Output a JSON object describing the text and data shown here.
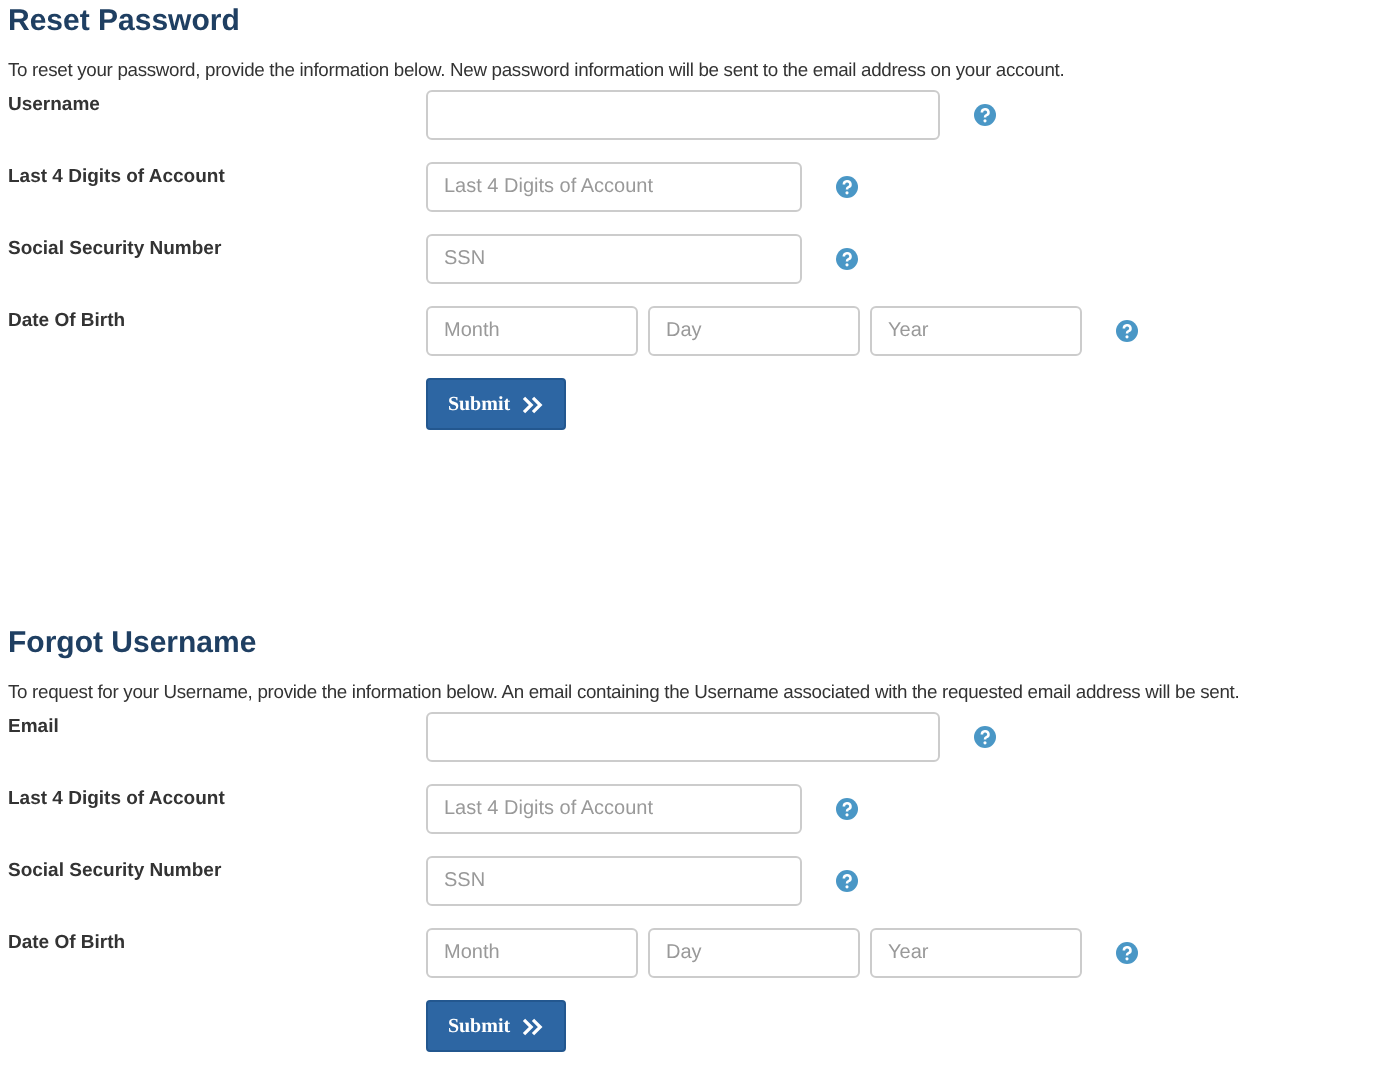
{
  "sections": [
    {
      "title": "Reset Password",
      "description": "To reset your password, provide the information below. New password information will be sent to the email address on your account.",
      "fields": [
        {
          "label": "Username",
          "kind": "long"
        },
        {
          "label": "Last 4 Digits of Account",
          "kind": "short",
          "inputs": [
            {
              "placeholder": "Last 4 Digits of Account"
            }
          ]
        },
        {
          "label": "Social Security Number",
          "kind": "short",
          "inputs": [
            {
              "placeholder": "SSN"
            }
          ]
        },
        {
          "label": "Date Of Birth",
          "kind": "date",
          "inputs": [
            {
              "placeholder": "Month"
            },
            {
              "placeholder": "Day"
            },
            {
              "placeholder": "Year"
            }
          ]
        }
      ],
      "button": "Submit"
    },
    {
      "title": "Forgot Username",
      "description": "To request for your Username, provide the information below. An email containing the Username associated with the requested email address will be sent.",
      "fields": [
        {
          "label": "Email",
          "kind": "long"
        },
        {
          "label": "Last 4 Digits of Account",
          "kind": "short",
          "inputs": [
            {
              "placeholder": "Last 4 Digits of Account"
            }
          ]
        },
        {
          "label": "Social Security Number",
          "kind": "short",
          "inputs": [
            {
              "placeholder": "SSN"
            }
          ]
        },
        {
          "label": "Date Of Birth",
          "kind": "date",
          "inputs": [
            {
              "placeholder": "Month"
            },
            {
              "placeholder": "Day"
            },
            {
              "placeholder": "Year"
            }
          ]
        }
      ],
      "button": "Submit"
    }
  ]
}
